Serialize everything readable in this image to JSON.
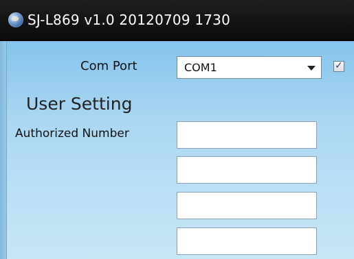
{
  "window": {
    "title": "SJ-L869 v1.0 20120709 1730"
  },
  "com_port": {
    "label": "Com Port",
    "selected_value": "COM1",
    "checkbox_checked": true
  },
  "user_setting": {
    "heading": "User Setting",
    "authorized_number_label": "Authorized Number",
    "authorized_numbers": [
      "",
      "",
      "",
      ""
    ]
  },
  "icons": {
    "app": "globe-icon",
    "dropdown": "chevron-down-icon",
    "check": "checkmark-icon"
  },
  "colors": {
    "titlebar": "#111111",
    "client_background": "#a9d6f2",
    "title_text": "#ffffff"
  }
}
